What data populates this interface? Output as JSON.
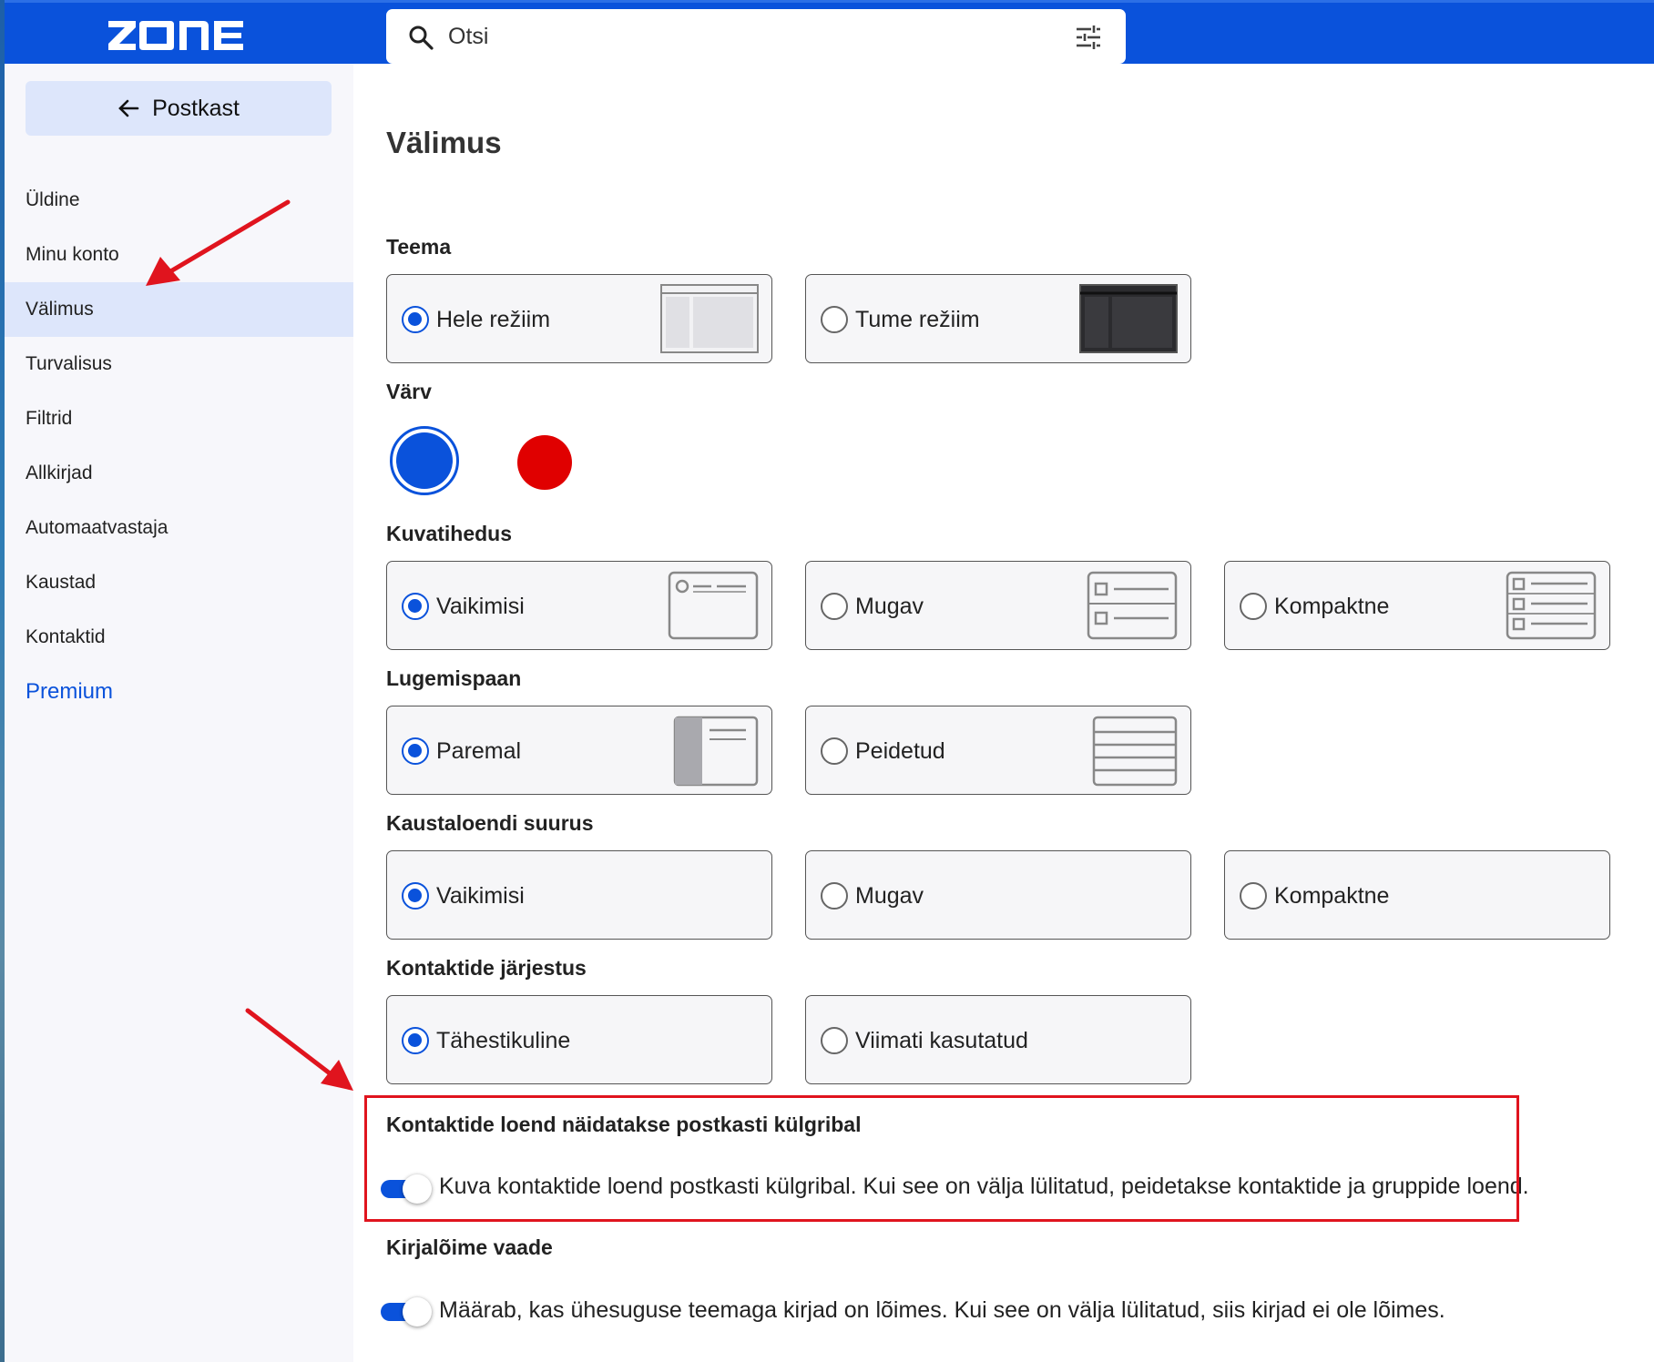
{
  "topbar": {
    "logo_text": "ZONE",
    "search_placeholder": "Otsi",
    "brand_color": "#0a52db"
  },
  "sidebar": {
    "back_label": "Postkast",
    "items": [
      {
        "label": "Üldine"
      },
      {
        "label": "Minu konto"
      },
      {
        "label": "Välimus",
        "active": true
      },
      {
        "label": "Turvalisus"
      },
      {
        "label": "Filtrid"
      },
      {
        "label": "Allkirjad"
      },
      {
        "label": "Automaatvastaja"
      },
      {
        "label": "Kaustad"
      },
      {
        "label": "Kontaktid"
      },
      {
        "label": "Premium",
        "accent": true
      }
    ]
  },
  "main": {
    "title": "Välimus",
    "theme": {
      "label": "Teema",
      "options": [
        {
          "label": "Hele režiim",
          "selected": true,
          "icon": "light-layout-icon"
        },
        {
          "label": "Tume režiim",
          "selected": false,
          "icon": "dark-layout-icon"
        }
      ]
    },
    "color": {
      "label": "Värv",
      "swatches": [
        {
          "color": "#0a52db",
          "selected": true
        },
        {
          "color": "#e00000",
          "selected": false
        }
      ]
    },
    "density": {
      "label": "Kuvatihedus",
      "options": [
        {
          "label": "Vaikimisi",
          "selected": true
        },
        {
          "label": "Mugav",
          "selected": false
        },
        {
          "label": "Kompaktne",
          "selected": false
        }
      ]
    },
    "reading_pane": {
      "label": "Lugemispaan",
      "options": [
        {
          "label": "Paremal",
          "selected": true
        },
        {
          "label": "Peidetud",
          "selected": false
        }
      ]
    },
    "folder_size": {
      "label": "Kaustaloendi suurus",
      "options": [
        {
          "label": "Vaikimisi",
          "selected": true
        },
        {
          "label": "Mugav",
          "selected": false
        },
        {
          "label": "Kompaktne",
          "selected": false
        }
      ]
    },
    "contact_order": {
      "label": "Kontaktide järjestus",
      "options": [
        {
          "label": "Tähestikuline",
          "selected": true
        },
        {
          "label": "Viimati kasutatud",
          "selected": false
        }
      ]
    },
    "contacts_sidebar": {
      "label": "Kontaktide loend näidatakse postkasti külgribal",
      "toggle_on": true,
      "description": "Kuva kontaktide loend postkasti külgribal. Kui see on välja lülitatud, peidetakse kontaktide ja gruppide loend."
    },
    "thread_view": {
      "label": "Kirjalõime vaade",
      "toggle_on": true,
      "description": "Määrab, kas ühesuguse teemaga kirjad on lõimes. Kui see on välja lülitatud, siis kirjad ei ole lõimes."
    }
  },
  "annotation": {
    "color": "#e0141e"
  }
}
